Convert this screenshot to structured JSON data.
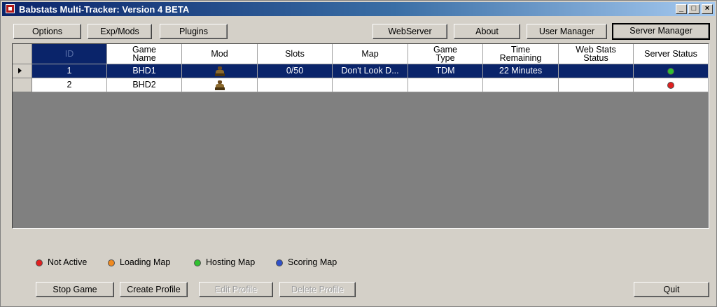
{
  "window": {
    "title": "Babstats Multi-Tracker: Version 4 BETA",
    "controls": {
      "minimize": "_",
      "maximize": "□",
      "close": "×"
    }
  },
  "toolbar": {
    "options": "Options",
    "exp_mods": "Exp/Mods",
    "plugins": "Plugins",
    "webserver": "WebServer",
    "about": "About",
    "user_manager": "User Manager",
    "server_manager": "Server Manager"
  },
  "table": {
    "headers": {
      "id": "ID",
      "game_name": "Game\nName",
      "mod": "Mod",
      "slots": "Slots",
      "map": "Map",
      "game_type": "Game\nType",
      "time_remaining": "Time\nRemaining",
      "web_stats_status": "Web Stats\nStatus",
      "server_status": "Server Status"
    },
    "rows": [
      {
        "id": "1",
        "game_name": "BHD1",
        "mod": "soldier-icon",
        "slots": "0/50",
        "map": "Don't Look D...",
        "game_type": "TDM",
        "time_remaining": "22 Minutes",
        "web_stats_status": "",
        "server_status": "hosting",
        "selected": true
      },
      {
        "id": "2",
        "game_name": "BHD2",
        "mod": "soldier-icon",
        "slots": "",
        "map": "",
        "game_type": "",
        "time_remaining": "",
        "web_stats_status": "",
        "server_status": "not-active",
        "selected": false
      }
    ]
  },
  "legend": [
    {
      "label": "Not Active",
      "color": "#e02020"
    },
    {
      "label": "Loading Map",
      "color": "#f08a20"
    },
    {
      "label": "Hosting Map",
      "color": "#30c030"
    },
    {
      "label": "Scoring Map",
      "color": "#3050c8"
    }
  ],
  "status_colors": {
    "hosting": "#30c030",
    "not-active": "#e02020"
  },
  "bottom_buttons": {
    "stop_game": "Stop Game",
    "create_profile": "Create Profile",
    "edit_profile": "Edit Profile",
    "delete_profile": "Delete Profile",
    "quit": "Quit"
  }
}
